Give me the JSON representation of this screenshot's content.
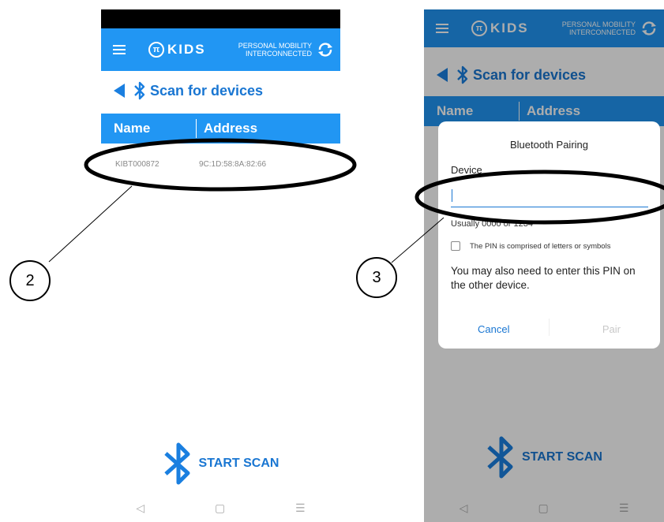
{
  "app": {
    "logo_mark": "π",
    "logo_text": "KIDS",
    "tagline_line1": "PERSONAL MOBILITY",
    "tagline_line2": "INTERCONNECTED"
  },
  "scan_screen": {
    "title": "Scan for devices",
    "columns": {
      "name": "Name",
      "address": "Address"
    },
    "devices": [
      {
        "name": "KIBT000872",
        "address": "9C:1D:58:8A:82:66"
      }
    ],
    "start_scan_label": "START SCAN"
  },
  "dialog": {
    "title": "Bluetooth Pairing",
    "device_label": "Device",
    "pin_value": "",
    "hint": "Usually 0000 or 1234",
    "checkbox_label": "The PIN is comprised of letters or symbols",
    "checkbox_checked": false,
    "message": "You may also need to enter this PIN on the other device.",
    "cancel_label": "Cancel",
    "pair_label": "Pair"
  },
  "navbar": {
    "back": "◁",
    "home": "▢",
    "recents": "☰"
  },
  "callouts": {
    "left": "2",
    "right": "3"
  },
  "colors": {
    "primary": "#2196f3",
    "accent_text": "#1976d2"
  },
  "icons": [
    "menu-icon",
    "logo-icon",
    "sync-icon",
    "back-arrow-icon",
    "bluetooth-icon"
  ]
}
